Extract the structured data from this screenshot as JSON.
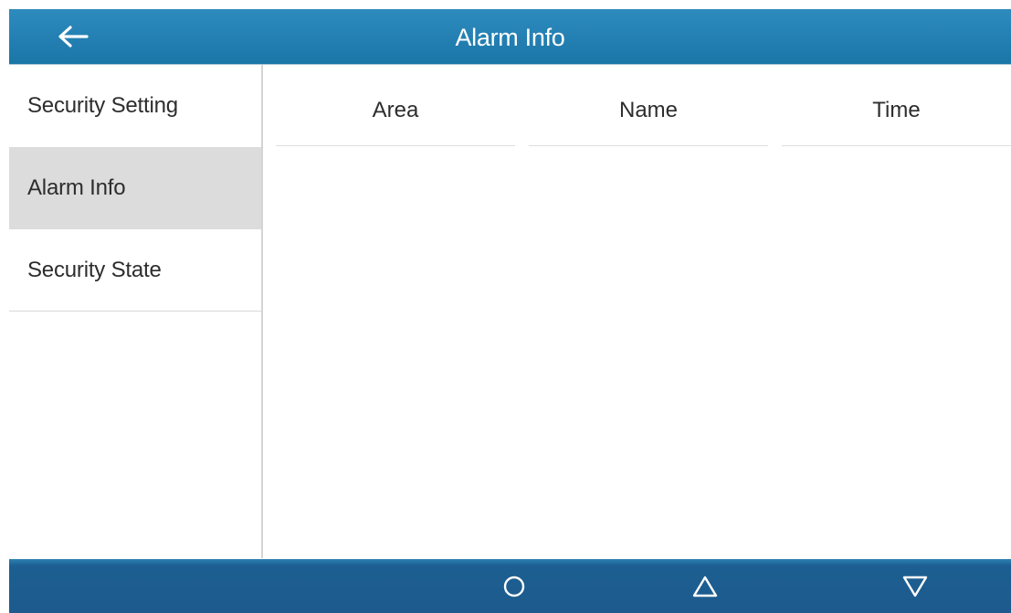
{
  "header": {
    "title": "Alarm Info",
    "back_icon": "arrow-left-icon"
  },
  "sidebar": {
    "items": [
      {
        "label": "Security Setting",
        "selected": false
      },
      {
        "label": "Alarm Info",
        "selected": true
      },
      {
        "label": "Security State",
        "selected": false
      }
    ]
  },
  "table": {
    "columns": [
      "Area",
      "Name",
      "Time"
    ],
    "rows": []
  },
  "bottom_nav": {
    "buttons": [
      {
        "icon": "circle-icon"
      },
      {
        "icon": "triangle-up-icon"
      },
      {
        "icon": "triangle-down-icon"
      }
    ]
  },
  "colors": {
    "header_bar": "#1b76a8",
    "bottom_bar": "#1d5a8d",
    "selected_item": "#dcdcdc"
  }
}
